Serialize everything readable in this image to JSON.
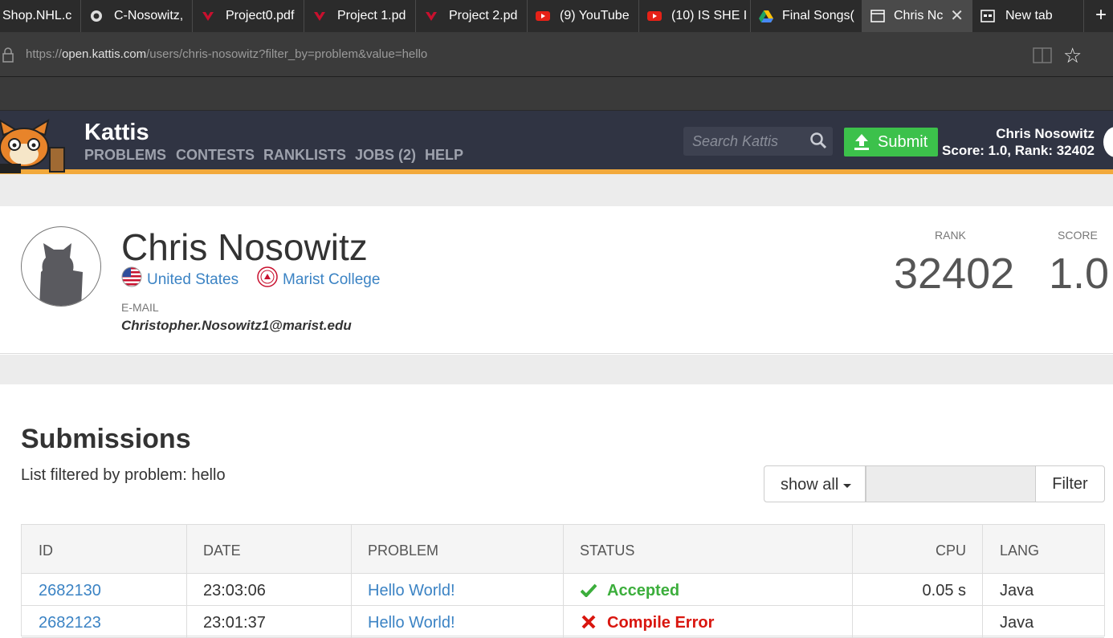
{
  "browser": {
    "tabs": [
      {
        "label": "Shop.NHL.c",
        "icon": "nhl-icon"
      },
      {
        "label": "C-Nosowitz,",
        "icon": "github-icon"
      },
      {
        "label": "Project0.pdf",
        "icon": "marist-icon"
      },
      {
        "label": "Project 1.pd",
        "icon": "marist-icon"
      },
      {
        "label": "Project 2.pd",
        "icon": "marist-icon"
      },
      {
        "label": "(9) YouTube",
        "icon": "youtube-icon"
      },
      {
        "label": "(10) IS SHE I",
        "icon": "youtube-icon"
      },
      {
        "label": "Final Songs(",
        "icon": "google-drive-icon"
      },
      {
        "label": "Chris Nc",
        "icon": "page-icon",
        "active": true
      },
      {
        "label": "New tab",
        "icon": "newtab-icon"
      }
    ],
    "new_tab_glyph": "+",
    "close_glyph": "✕",
    "url_scheme": "https://",
    "url_host": "open.kattis.com",
    "url_path": "/users/chris-nosowitz?filter_by=problem&value=hello"
  },
  "site": {
    "brand": "Kattis",
    "nav": [
      "PROBLEMS",
      "CONTESTS",
      "RANKLISTS",
      "JOBS (2)",
      "HELP"
    ],
    "search_placeholder": "Search Kattis",
    "submit_label": "Submit",
    "user_name": "Chris Nosowitz",
    "user_score_line": "Score: 1.0, Rank: 32402"
  },
  "profile": {
    "name": "Chris Nosowitz",
    "country": "United States",
    "school": "Marist College",
    "email_label": "E-MAIL",
    "email": "Christopher.Nosowitz1@marist.edu",
    "rank_label": "RANK",
    "rank": "32402",
    "score_label": "SCORE",
    "score": "1.0"
  },
  "submissions": {
    "title": "Submissions",
    "filter_text": "List filtered by problem: hello",
    "show_all_label": "show all",
    "filter_button": "Filter",
    "columns": [
      "ID",
      "DATE",
      "PROBLEM",
      "STATUS",
      "CPU",
      "LANG"
    ],
    "rows": [
      {
        "id": "2682130",
        "date": "23:03:06",
        "problem": "Hello World!",
        "status": "Accepted",
        "status_kind": "ok",
        "cpu": "0.05 s",
        "lang": "Java"
      },
      {
        "id": "2682123",
        "date": "23:01:37",
        "problem": "Hello World!",
        "status": "Compile Error",
        "status_kind": "err",
        "cpu": "",
        "lang": "Java"
      }
    ]
  },
  "colors": {
    "header": "#303443",
    "accent": "#f2a93b",
    "submit": "#3cc14b",
    "link": "#3b83c4"
  }
}
